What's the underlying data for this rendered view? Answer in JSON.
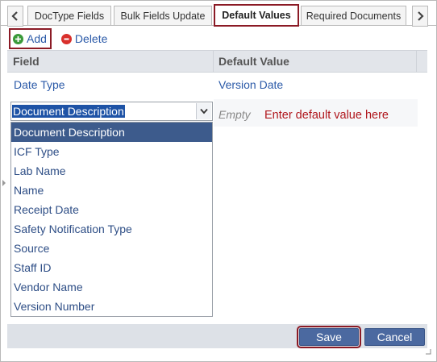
{
  "tabs": {
    "items": [
      "DocType Fields",
      "Bulk Fields Update",
      "Default Values",
      "Required Documents"
    ],
    "active": "Default Values"
  },
  "toolbar": {
    "add_label": "Add",
    "delete_label": "Delete"
  },
  "grid": {
    "headers": [
      "Field",
      "Default Value"
    ],
    "rows": [
      {
        "field": "Date Type",
        "value": "Version Date"
      }
    ],
    "editing": {
      "selected_field": "Document Description",
      "value_placeholder": "Empty",
      "hint": "Enter default value here"
    }
  },
  "dropdown": {
    "options": [
      "Document Description",
      "ICF Type",
      "Lab Name",
      "Name",
      "Receipt Date",
      "Safety Notification Type",
      "Source",
      "Staff ID",
      "Vendor Name",
      "Version Number"
    ],
    "selected": "Document Description"
  },
  "footer": {
    "save_label": "Save",
    "cancel_label": "Cancel"
  },
  "colors": {
    "accent_blue": "#4b69a0",
    "highlight_red": "#8b1a25",
    "hint_red": "#b0161c",
    "link_blue": "#2b5aa8"
  },
  "icons": [
    "arrow-left-icon",
    "arrow-right-icon",
    "add-icon",
    "delete-icon",
    "chevron-down-icon",
    "resize-grip-icon"
  ]
}
